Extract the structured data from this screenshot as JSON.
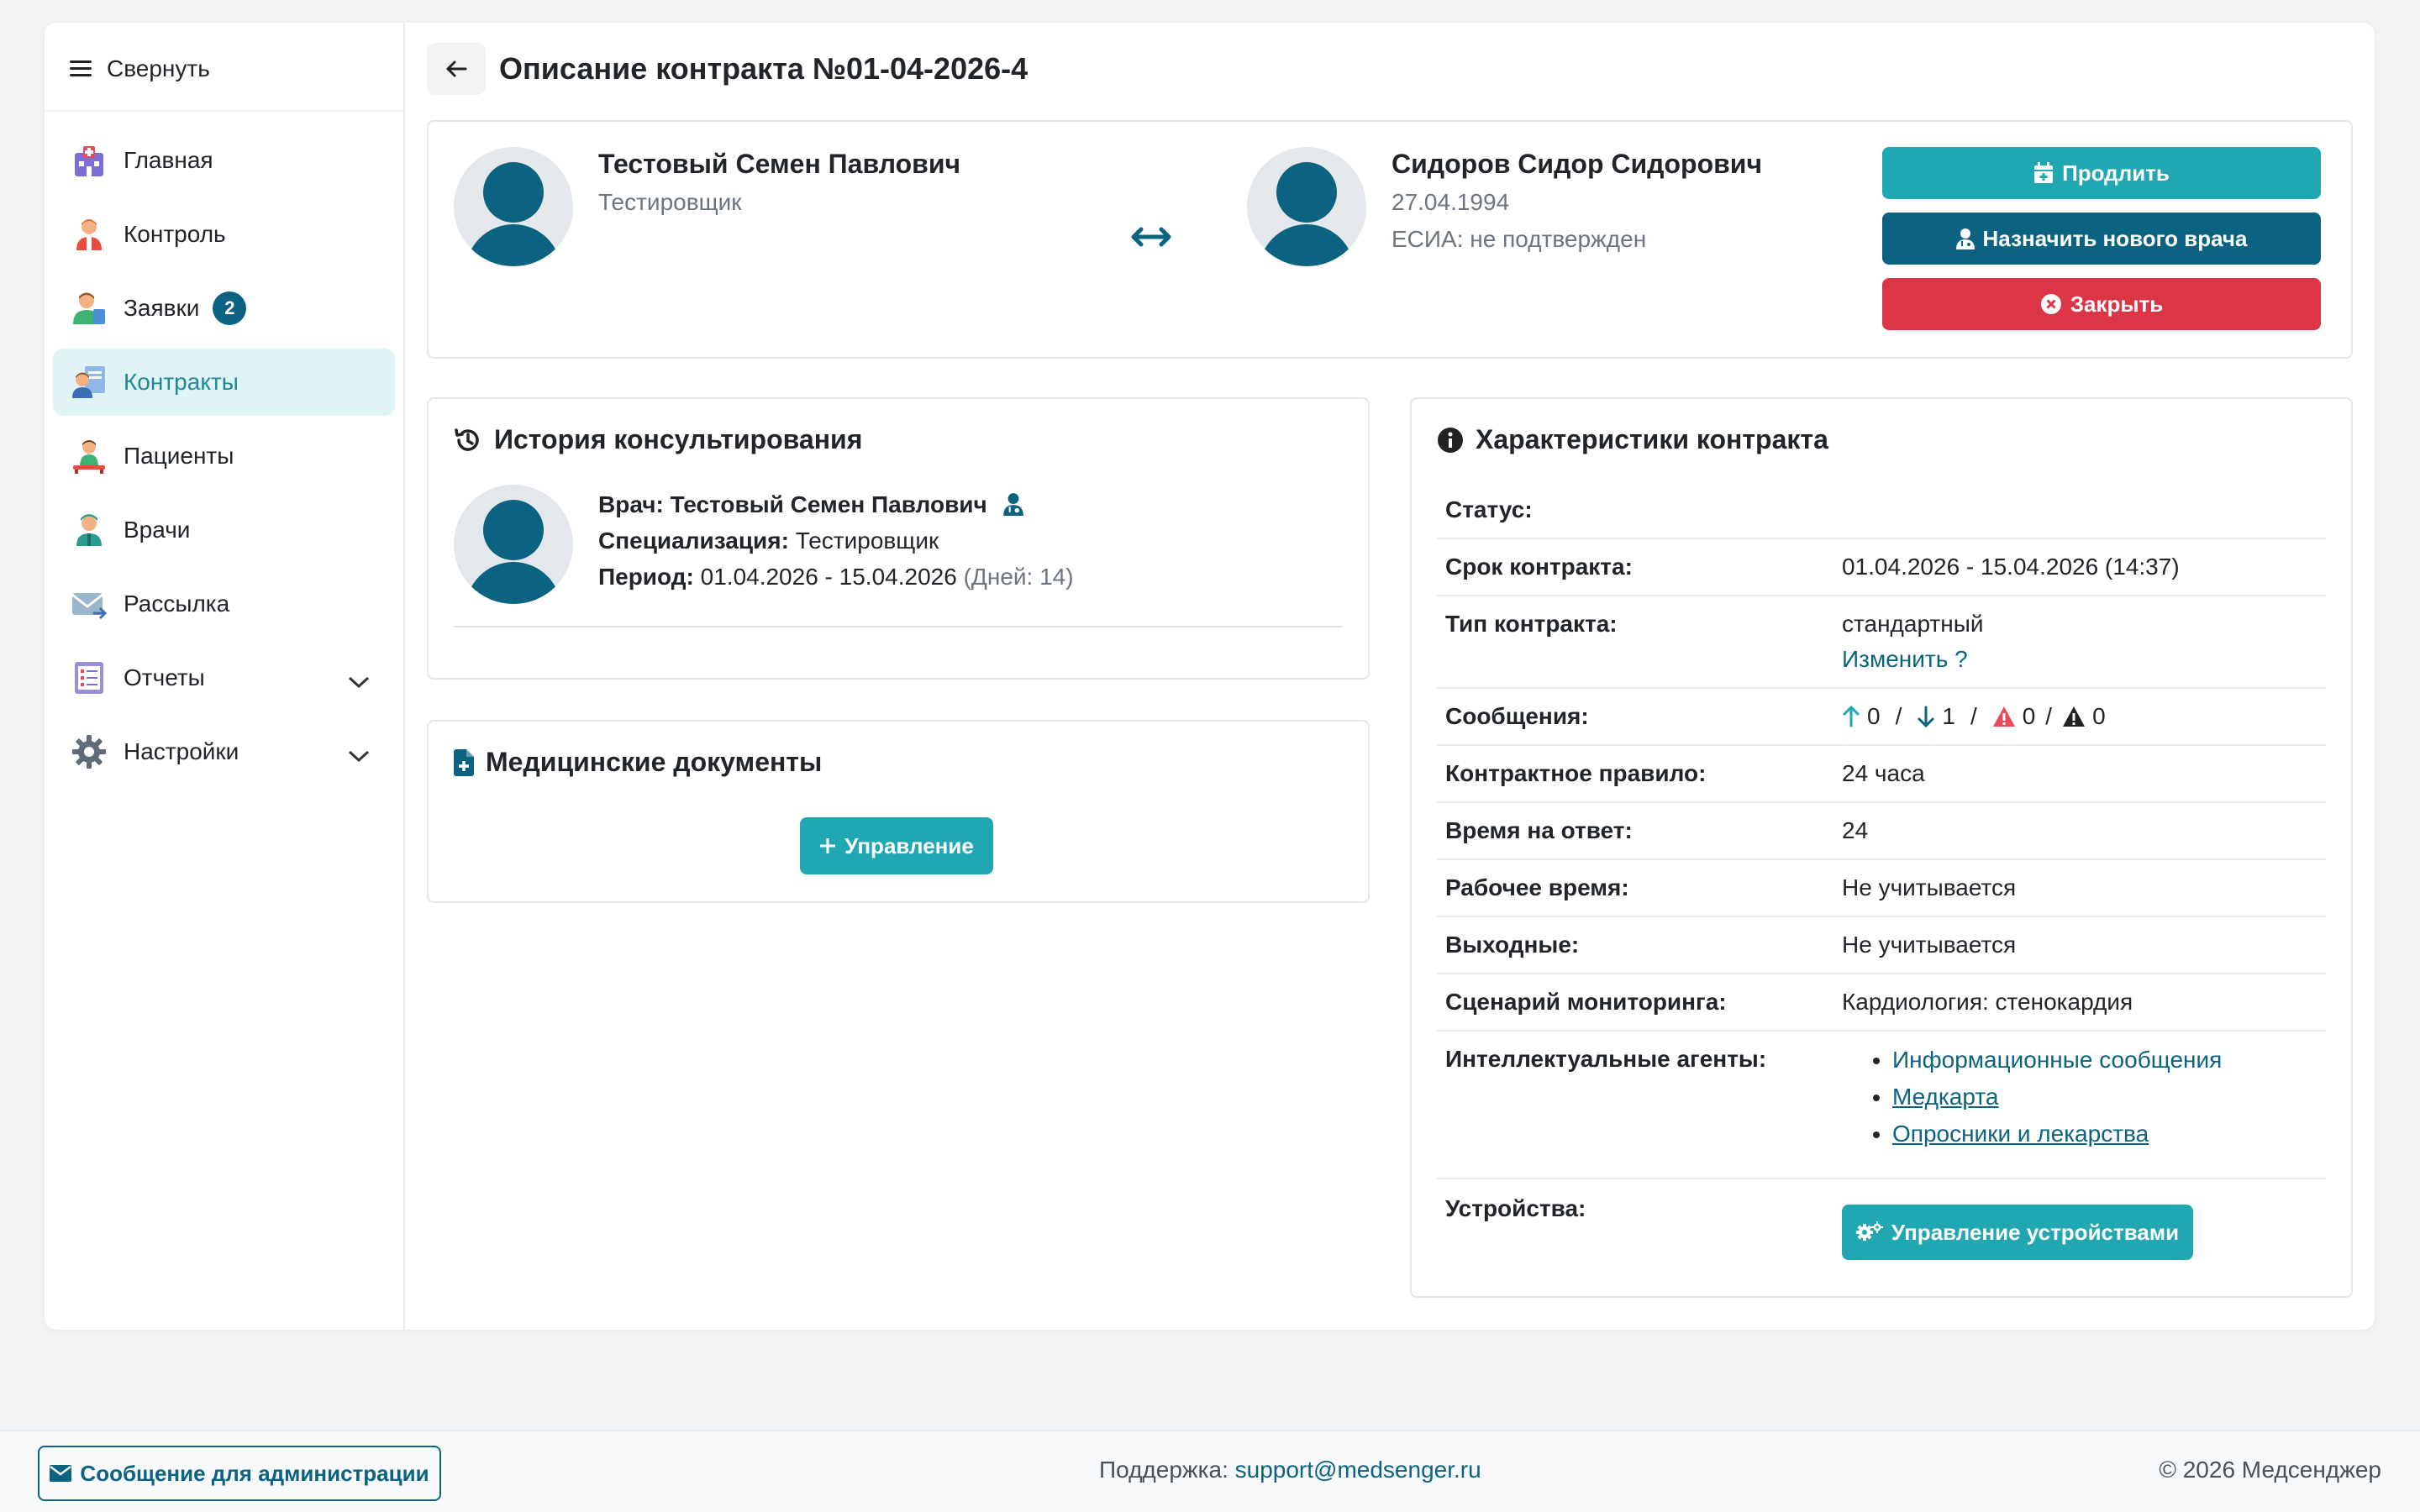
{
  "sidebar": {
    "collapse_label": "Свернуть",
    "items": [
      {
        "label": "Главная",
        "icon": "hospital-icon"
      },
      {
        "label": "Контроль",
        "icon": "doctor-icon"
      },
      {
        "label": "Заявки",
        "icon": "request-icon",
        "badge": "2"
      },
      {
        "label": "Контракты",
        "icon": "contract-icon"
      },
      {
        "label": "Пациенты",
        "icon": "patient-icon"
      },
      {
        "label": "Врачи",
        "icon": "physician-icon"
      },
      {
        "label": "Рассылка",
        "icon": "mail-icon"
      },
      {
        "label": "Отчеты",
        "icon": "report-icon"
      },
      {
        "label": "Настройки",
        "icon": "gear-icon"
      }
    ]
  },
  "header": {
    "title": "Описание контракта №01-04-2026-4"
  },
  "contract": {
    "doctor": {
      "name": "Тестовый Семен Павлович",
      "role": "Тестировщик"
    },
    "patient": {
      "name": "Сидоров Сидор Сидорович",
      "birth": "27.04.1994",
      "esia": "ЕСИА: не подтвержден"
    },
    "buttons": {
      "extend": "Продлить",
      "assign": "Назначить нового врача",
      "close": "Закрыть"
    }
  },
  "history": {
    "title": "История консультирования",
    "doctor_label": "Врач:",
    "doctor_value": "Тестовый Семен Павлович",
    "spec_label": "Специализация:",
    "spec_value": "Тестировщик",
    "period_label": "Период:",
    "period_value": "01.04.2026 - 15.04.2026",
    "period_days": "(Дней: 14)"
  },
  "docs": {
    "title": "Медицинские документы",
    "manage_label": "Управление"
  },
  "chars": {
    "title": "Характеристики контракта",
    "status_label": "Статус:",
    "term_label": "Срок контракта:",
    "term_value": "01.04.2026 - 15.04.2026 (14:37)",
    "type_label": "Тип контракта:",
    "type_value": "стандартный",
    "type_change": "Изменить ?",
    "messages_label": "Сообщения:",
    "msg_up": "0",
    "msg_down": "1",
    "msg_warn": "0",
    "msg_alert": "0",
    "slash": "/",
    "rule_label": "Контрактное правило:",
    "rule_value": "24 часа",
    "response_label": "Время на ответ:",
    "response_value": "24",
    "work_label": "Рабочее время:",
    "work_value": "Не учитывается",
    "weekend_label": "Выходные:",
    "weekend_value": "Не учитывается",
    "scenario_label": "Сценарий мониторинга:",
    "scenario_value": "Кардиология: стенокардия",
    "agents_label": "Интеллектуальные агенты:",
    "agents": [
      "Информационные сообщения",
      "Медкарта",
      "Опросники и лекарства"
    ],
    "devices_label": "Устройства:",
    "devices_button": "Управление устройствами"
  },
  "footer": {
    "admin_button": "Сообщение для администрации",
    "support_label": "Поддержка:",
    "support_email": "support@medsenger.ru",
    "copyright": "© 2026 Медсенджер"
  },
  "colors": {
    "teal": "#21a7b2",
    "dark_teal": "#0b6381",
    "red": "#dc3545",
    "active_bg": "#e0f4f5"
  }
}
